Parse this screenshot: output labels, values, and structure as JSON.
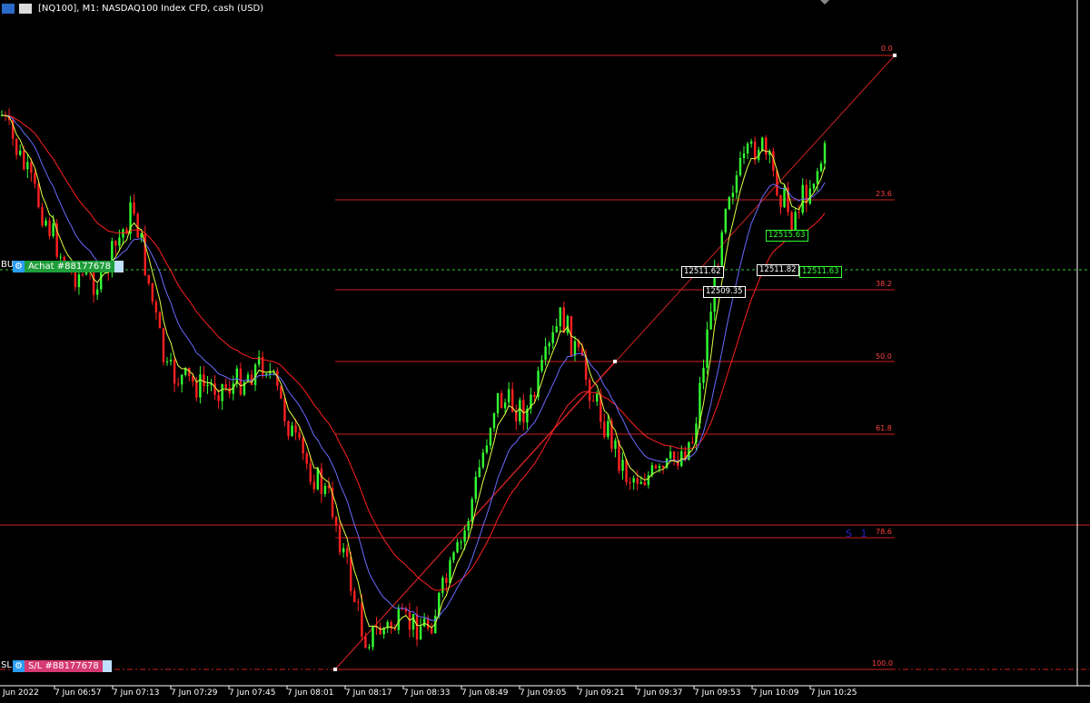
{
  "title": "[NQ100], M1:  NASDAQ100 Index CFD, cash (USD)",
  "icons": [
    "menu-icon",
    "chart-icon"
  ],
  "fib_levels": [
    {
      "label": "0.0"
    },
    {
      "label": "23.6"
    },
    {
      "label": "38.2"
    },
    {
      "label": "50.0"
    },
    {
      "label": "61.8"
    },
    {
      "label": "78.6"
    },
    {
      "label": "100.0"
    }
  ],
  "orders": {
    "buy": {
      "side_label": "BU",
      "label": "Achat #88177678",
      "color": "#1e9e3a"
    },
    "sl": {
      "side_label": "SL",
      "label": "S/L #88177678",
      "color": "#d63a72"
    }
  },
  "price_labels": [
    "12511.62",
    "12509.35",
    "12511.82",
    "12515.63",
    "12511.63"
  ],
  "s1_label": "S 1",
  "time_axis": [
    "Jun 2022",
    "7 Jun 06:57",
    "7 Jun 07:13",
    "7 Jun 07:29",
    "7 Jun 07:45",
    "7 Jun 08:01",
    "7 Jun 08:17",
    "7 Jun 08:33",
    "7 Jun 08:49",
    "7 Jun 09:05",
    "7 Jun 09:21",
    "7 Jun 09:37",
    "7 Jun 09:53",
    "7 Jun 10:09",
    "7 Jun 10:25"
  ],
  "colors": {
    "bull": "#33ff33",
    "bear": "#ff2020",
    "fib": "#cc2222",
    "ma_fast": "#dfff40",
    "ma_mid": "#6a6aff",
    "ma_slow": "#ff2020",
    "grid_dash": "#33cc33"
  },
  "chart_data": {
    "type": "candlestick",
    "symbol": "NQ100",
    "timeframe": "M1",
    "close_path": [
      {
        "t": "7 Jun 06:50",
        "v": 0.86
      },
      {
        "t": "7 Jun 06:57",
        "v": 0.74
      },
      {
        "t": "7 Jun 07:01",
        "v": 0.62
      },
      {
        "t": "7 Jun 07:13",
        "v": 0.6
      },
      {
        "t": "7 Jun 07:22",
        "v": 0.72
      },
      {
        "t": "7 Jun 07:29",
        "v": 0.46
      },
      {
        "t": "7 Jun 07:35",
        "v": 0.44
      },
      {
        "t": "7 Jun 07:45",
        "v": 0.44
      },
      {
        "t": "7 Jun 07:53",
        "v": 0.48
      },
      {
        "t": "7 Jun 08:01",
        "v": 0.34
      },
      {
        "t": "7 Jun 08:09",
        "v": 0.26
      },
      {
        "t": "7 Jun 08:17",
        "v": 0.05
      },
      {
        "t": "7 Jun 08:33",
        "v": 0.07
      },
      {
        "t": "7 Jun 08:49",
        "v": 0.07
      },
      {
        "t": "7 Jun 08:55",
        "v": 0.2
      },
      {
        "t": "7 Jun 09:05",
        "v": 0.42
      },
      {
        "t": "7 Jun 09:13",
        "v": 0.4
      },
      {
        "t": "7 Jun 09:21",
        "v": 0.55
      },
      {
        "t": "7 Jun 09:29",
        "v": 0.42
      },
      {
        "t": "7 Jun 09:37",
        "v": 0.3
      },
      {
        "t": "7 Jun 09:45",
        "v": 0.3
      },
      {
        "t": "7 Jun 09:53",
        "v": 0.36
      },
      {
        "t": "7 Jun 10:03",
        "v": 0.74
      },
      {
        "t": "7 Jun 10:09",
        "v": 0.82
      },
      {
        "t": "7 Jun 10:15",
        "v": 0.7
      },
      {
        "t": "7 Jun 10:25",
        "v": 0.8
      }
    ],
    "moving_averages": [
      "ma_fast",
      "ma_mid",
      "ma_slow"
    ]
  }
}
